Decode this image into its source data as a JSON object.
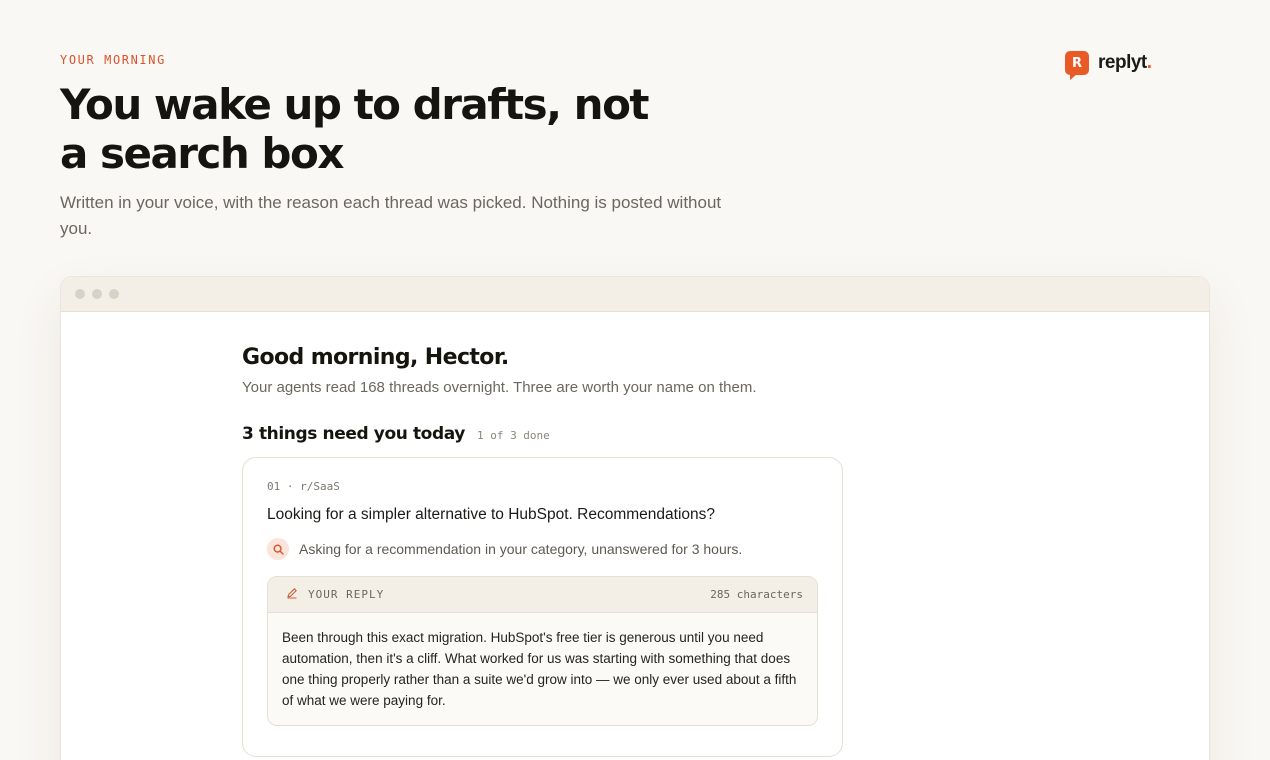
{
  "hero": {
    "eyebrow": "YOUR MORNING",
    "title": "You wake up to drafts, not a search box",
    "subtitle": "Written in your voice, with the reason each thread was picked. Nothing is posted without you."
  },
  "brand": {
    "mark_letter": "R",
    "name": "replyt",
    "dot": ".",
    "accent_color": "#ea5a26"
  },
  "app": {
    "greeting": "Good morning, Hector.",
    "greeting_sub": "Your agents read 168 threads overnight. Three are worth your name on them.",
    "section_title": "3 things need you today",
    "section_count": "1 of 3 done",
    "card": {
      "meta": "01 · r/SaaS",
      "title": "Looking for a simpler alternative to HubSpot. Recommendations?",
      "reason_icon": "search-icon",
      "reason": "Asking for a recommendation in your category, unanswered for 3 hours.",
      "reply_label": "YOUR REPLY",
      "reply_icon": "pencil-icon",
      "reply_chars": "285 characters",
      "reply_text": "Been through this exact migration. HubSpot's free tier is generous until you need automation, then it's a cliff. What worked for us was starting with something that does one thing properly rather than a suite we'd grow into — we only ever used about a fifth of what we were paying for."
    }
  }
}
